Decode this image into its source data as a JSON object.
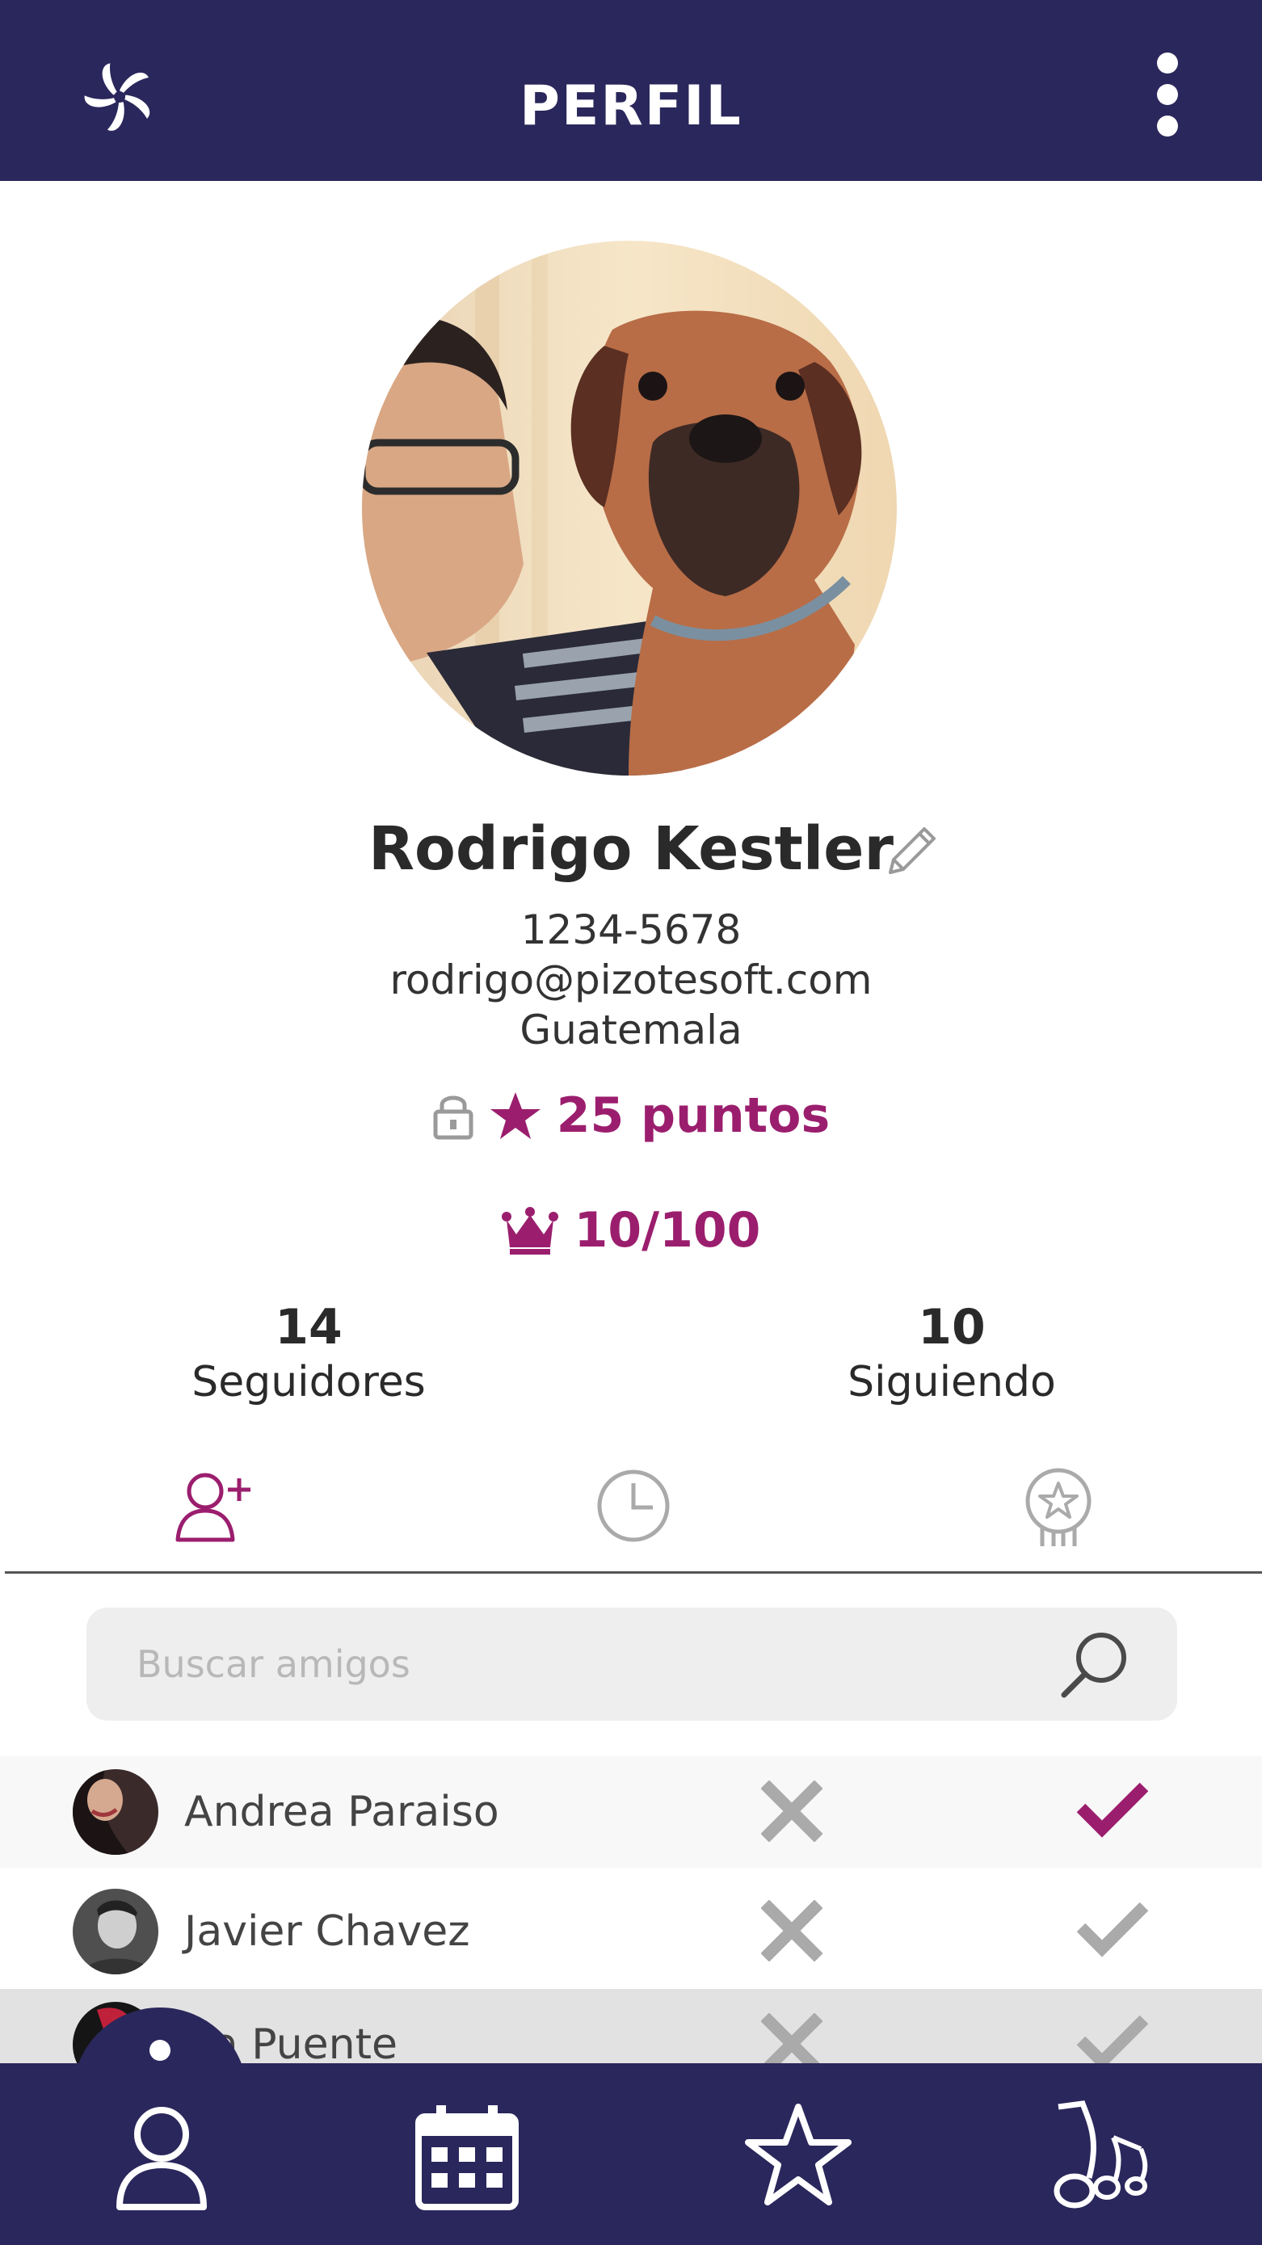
{
  "header": {
    "title": "PERFIL",
    "logo_icon": "pinwheel-logo-icon",
    "menu_icon": "more-vertical-icon"
  },
  "profile": {
    "name": "Rodrigo Kestler",
    "phone": "1234-5678",
    "email": "rodrigo@pizotesoft.com",
    "country": "Guatemala",
    "points": "25 puntos",
    "rank": "10/100"
  },
  "stats": {
    "followers_count": "14",
    "followers_label": "Seguidores",
    "following_count": "10",
    "following_label": "Siguiendo"
  },
  "tabs": [
    {
      "icon": "add-user-icon",
      "active": true
    },
    {
      "icon": "clock-icon",
      "active": false
    },
    {
      "icon": "award-badge-icon",
      "active": false
    }
  ],
  "search": {
    "placeholder": "Buscar amigos",
    "value": ""
  },
  "friends": [
    {
      "name": "Andrea Paraiso",
      "accept_color": "#9b1e6e",
      "highlight": "#f8f8f8"
    },
    {
      "name": "Javier Chavez",
      "accept_color": "#aaaaaa",
      "highlight": "#ffffff"
    },
    {
      "name": "Anita Puente",
      "visible_name": "ita Puente",
      "accept_color": "#aaaaaa",
      "highlight": "#e2e2e2"
    }
  ],
  "bottom_nav": [
    {
      "icon": "user-icon"
    },
    {
      "icon": "calendar-icon"
    },
    {
      "icon": "star-icon"
    },
    {
      "icon": "music-notes-icon"
    }
  ],
  "colors": {
    "primary": "#2a275c",
    "accent": "#9b1e6e",
    "muted_icon": "#aaaaaa"
  }
}
